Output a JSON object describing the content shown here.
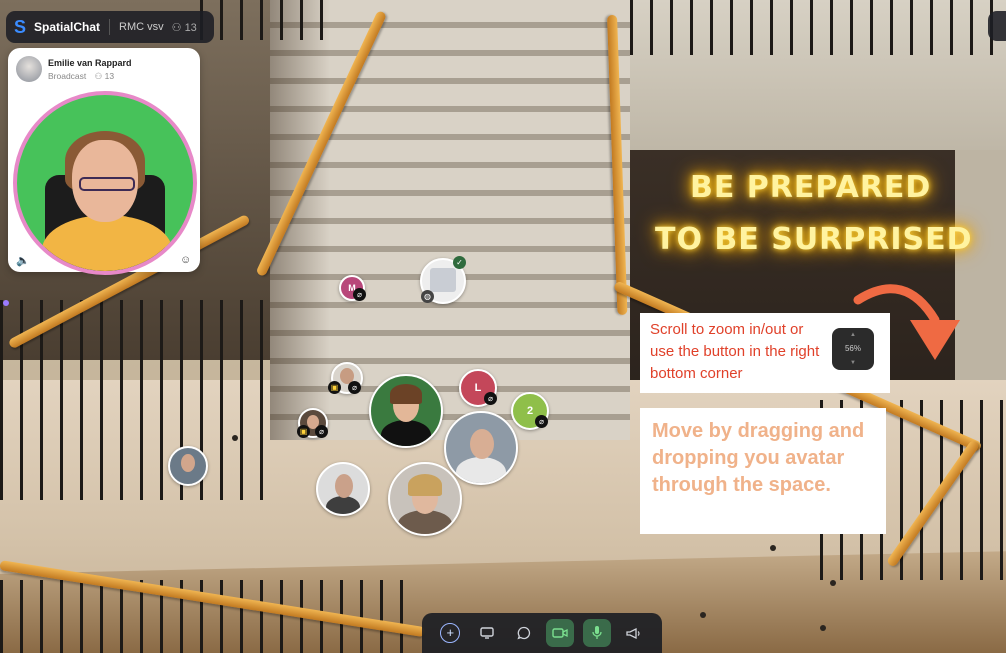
{
  "app": {
    "brand": "SpatialChat",
    "room_name": "RMC vsv",
    "room_count": "13",
    "logo_icon": "spatialchat-logo-icon",
    "accent_color": "#3b8cff"
  },
  "broadcast": {
    "name": "Emilie van Rappard",
    "label": "Broadcast",
    "viewer_count": "13",
    "border_color": "#e789c8"
  },
  "neon": {
    "line1": "BE PREPARED",
    "line2": "TO BE SURPRISED"
  },
  "tips": {
    "zoom_tip": "Scroll to zoom in/out or use the button in the right bottom corner",
    "zoom_level": "56%",
    "move_tip": "Move by dragging and dropping you avatar through the space."
  },
  "avatars": {
    "m": "M",
    "l": "L",
    "two": "2",
    "card_tag": "✓"
  },
  "toolbar": {
    "add_label": "+",
    "share_icon": "screen-share-icon",
    "chat_icon": "chat-icon",
    "camera_icon": "camera-icon",
    "mic_icon": "microphone-icon",
    "broadcast_icon": "megaphone-icon"
  }
}
